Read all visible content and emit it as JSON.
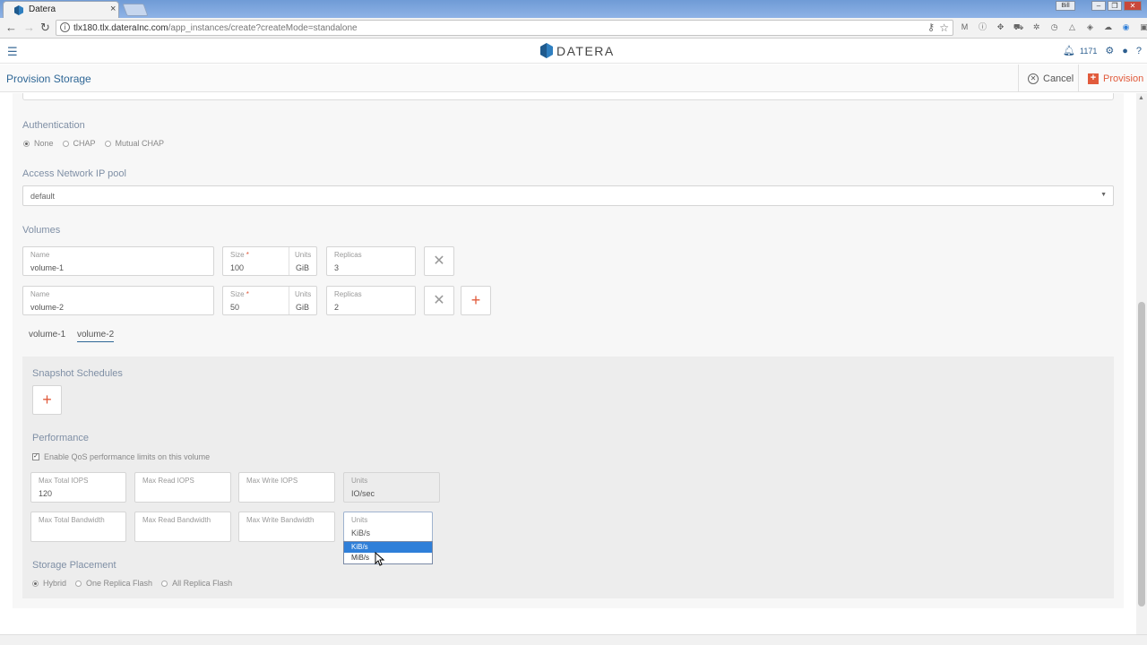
{
  "browser": {
    "tab_title": "Datera",
    "tab_close": "×",
    "url_host": "tlx180.tlx.dateraInc.com",
    "url_path": "/app_instances/create?createMode=standalone",
    "window_user": "Bill"
  },
  "app": {
    "logo_text": "DATERA",
    "notification_count": "1171"
  },
  "page": {
    "title": "Provision Storage",
    "cancel_label": "Cancel",
    "provision_label": "Provision"
  },
  "authentication": {
    "label": "Authentication",
    "options": [
      {
        "label": "None",
        "selected": true
      },
      {
        "label": "CHAP",
        "selected": false
      },
      {
        "label": "Mutual CHAP",
        "selected": false
      }
    ]
  },
  "ip_pool": {
    "label": "Access Network IP pool",
    "value": "default"
  },
  "volumes": {
    "label": "Volumes",
    "name_label": "Name",
    "size_label": "Size",
    "required_mark": "*",
    "units_label": "Units",
    "replicas_label": "Replicas",
    "rows": [
      {
        "name": "volume-1",
        "size": "100",
        "units": "GiB",
        "replicas": "3"
      },
      {
        "name": "volume-2",
        "size": "50",
        "units": "GiB",
        "replicas": "2"
      }
    ],
    "tabs": [
      {
        "label": "volume-1",
        "active": false
      },
      {
        "label": "volume-2",
        "active": true
      }
    ]
  },
  "snapshot": {
    "label": "Snapshot Schedules"
  },
  "performance": {
    "label": "Performance",
    "qos_label": "Enable QoS performance limits on this volume",
    "qos_checked": true,
    "max_total_iops_label": "Max Total IOPS",
    "max_total_iops_value": "120",
    "max_read_iops_label": "Max Read IOPS",
    "max_write_iops_label": "Max Write IOPS",
    "iops_units_label": "Units",
    "iops_units_value": "IO/sec",
    "max_total_bw_label": "Max Total Bandwidth",
    "max_read_bw_label": "Max Read Bandwidth",
    "max_write_bw_label": "Max Write Bandwidth",
    "bw_units_label": "Units",
    "bw_units_value": "KiB/s",
    "bw_units_options": [
      "KiB/s",
      "MiB/s"
    ]
  },
  "placement": {
    "label": "Storage Placement",
    "options": [
      {
        "label": "Hybrid",
        "selected": true
      },
      {
        "label": "One Replica Flash",
        "selected": false
      },
      {
        "label": "All Replica Flash",
        "selected": false
      }
    ]
  },
  "colors": {
    "accent_blue": "#2f6796",
    "accent_orange": "#e15b3c",
    "dropdown_highlight": "#2f7fd9"
  }
}
